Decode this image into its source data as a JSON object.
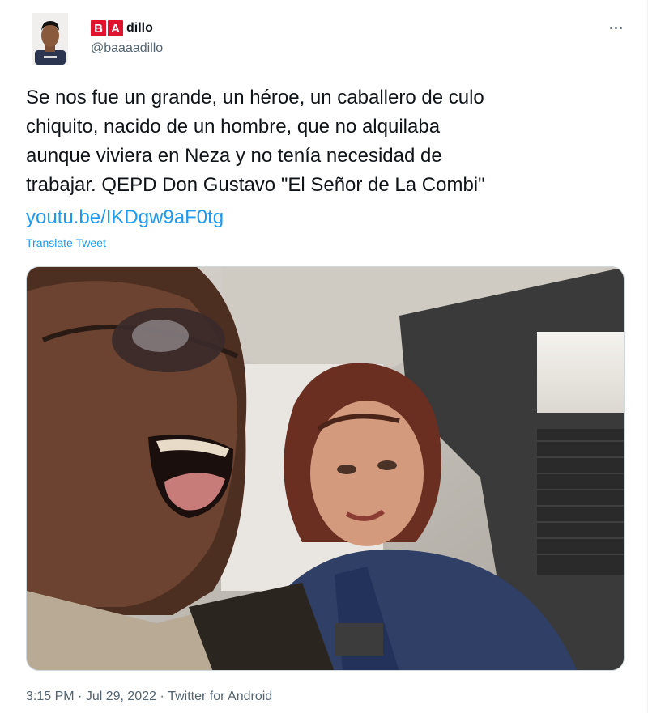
{
  "author": {
    "name_boxes": [
      "B",
      "A"
    ],
    "name_rest": "dillo",
    "handle": "@baaaadillo",
    "avatar_icon": "user-avatar",
    "badge_color": "#e0142e"
  },
  "menu": {
    "more_label": "···",
    "more_icon": "more-horizontal-icon"
  },
  "tweet": {
    "text": "Se nos fue un grande, un héroe, un caballero de culo\nchiquito, nacido de un hombre, que no alquilaba\naunque viviera en Neza y no tenía necesidad de\ntrabajar. QEPD Don Gustavo \"El Señor de La Combi\"",
    "link": "youtu.be/IKDgw9aF0tg",
    "translate": "Translate Tweet"
  },
  "media": {
    "kind": "photo",
    "subject_icon": "video-still-image"
  },
  "meta": {
    "time": "3:15 PM",
    "separator1": " · ",
    "date": "Jul 29, 2022",
    "separator2": " · ",
    "source": "Twitter for Android"
  },
  "colors": {
    "link": "#1d9bf0",
    "secondary_text": "#536471",
    "primary_text": "#0f1419"
  }
}
